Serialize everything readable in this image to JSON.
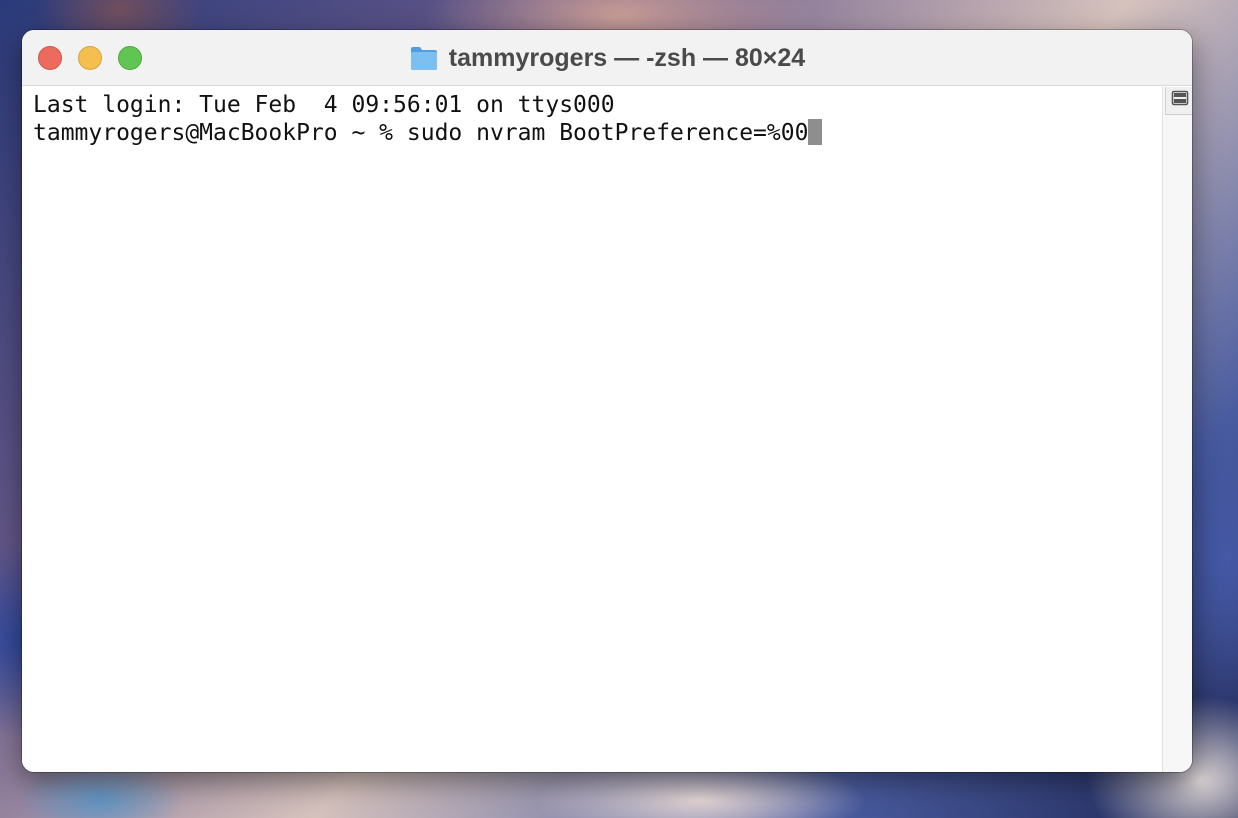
{
  "window": {
    "title": "tammyrogers — -zsh — 80×24",
    "folder_icon": "folder-icon",
    "controls": {
      "close": "close-button",
      "minimize": "minimize-button",
      "zoom": "zoom-button"
    }
  },
  "terminal": {
    "lines": [
      "Last login: Tue Feb  4 09:56:01 on ttys000",
      "tammyrogers@MacBookPro ~ % sudo nvram BootPreference=%00"
    ],
    "cursor": "block-cursor"
  },
  "scrollbar": {
    "split_icon": "split-pane-icon"
  },
  "colors": {
    "close": "#ec6a5e",
    "minimize": "#f4bf4f",
    "zoom": "#61c554",
    "folder": "#6cb3ec",
    "cursor": "#8e8e8e"
  }
}
